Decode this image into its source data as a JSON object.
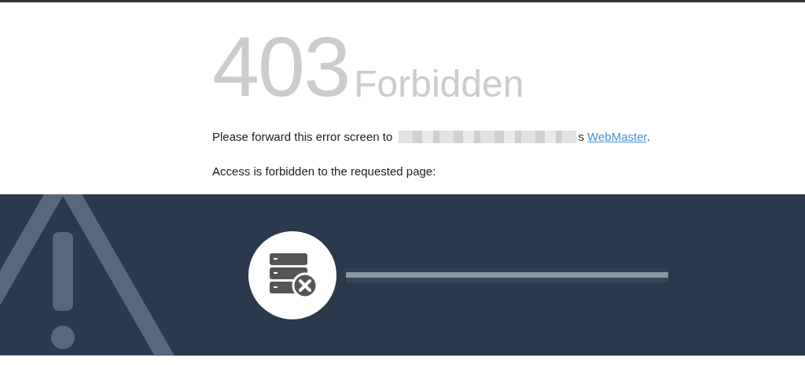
{
  "error": {
    "code": "403",
    "title": "Forbidden"
  },
  "message": {
    "before": "Please forward this error screen to",
    "after": "s",
    "link": "WebMaster",
    "end": "."
  },
  "detail": "Access is forbidden to the requested page:"
}
